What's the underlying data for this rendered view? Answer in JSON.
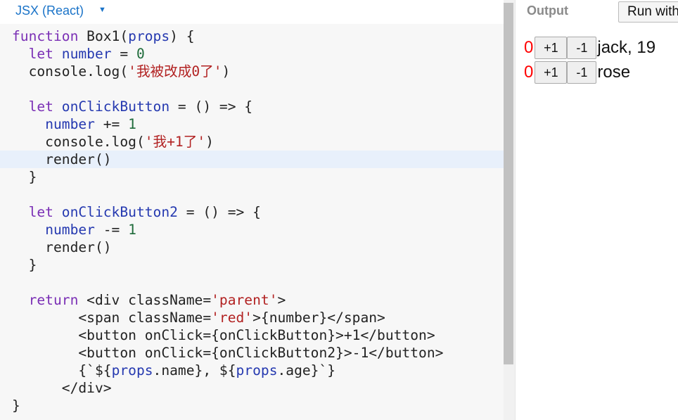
{
  "editor": {
    "language": "JSX (React)",
    "caret": "▼",
    "lines": [
      [
        {
          "t": "function",
          "c": "kw"
        },
        {
          "t": " Box1("
        },
        {
          "t": "props",
          "c": "var"
        },
        {
          "t": ") {"
        }
      ],
      [
        {
          "t": "  "
        },
        {
          "t": "let",
          "c": "kw"
        },
        {
          "t": " "
        },
        {
          "t": "number",
          "c": "var"
        },
        {
          "t": " = "
        },
        {
          "t": "0",
          "c": "num"
        }
      ],
      [
        {
          "t": "  console.log("
        },
        {
          "t": "'我被改成0了'",
          "c": "str"
        },
        {
          "t": ")"
        }
      ],
      [],
      [
        {
          "t": "  "
        },
        {
          "t": "let",
          "c": "kw"
        },
        {
          "t": " "
        },
        {
          "t": "onClickButton",
          "c": "var"
        },
        {
          "t": " = () => {"
        }
      ],
      [
        {
          "t": "    "
        },
        {
          "t": "number",
          "c": "var"
        },
        {
          "t": " += "
        },
        {
          "t": "1",
          "c": "num"
        }
      ],
      [
        {
          "t": "    console.log("
        },
        {
          "t": "'我+1了'",
          "c": "str"
        },
        {
          "t": ")"
        }
      ],
      [
        {
          "t": "    render()"
        }
      ],
      [
        {
          "t": "  }"
        }
      ],
      [],
      [
        {
          "t": "  "
        },
        {
          "t": "let",
          "c": "kw"
        },
        {
          "t": " "
        },
        {
          "t": "onClickButton2",
          "c": "var"
        },
        {
          "t": " = () => {"
        }
      ],
      [
        {
          "t": "    "
        },
        {
          "t": "number",
          "c": "var"
        },
        {
          "t": " -= "
        },
        {
          "t": "1",
          "c": "num"
        }
      ],
      [
        {
          "t": "    render()"
        }
      ],
      [
        {
          "t": "  }"
        }
      ],
      [],
      [
        {
          "t": "  "
        },
        {
          "t": "return",
          "c": "kw"
        },
        {
          "t": " <div className="
        },
        {
          "t": "'parent'",
          "c": "str"
        },
        {
          "t": ">"
        }
      ],
      [
        {
          "t": "        <span className="
        },
        {
          "t": "'red'",
          "c": "str"
        },
        {
          "t": ">{number}</span>"
        }
      ],
      [
        {
          "t": "        <button onClick={onClickButton}>+1</button>"
        }
      ],
      [
        {
          "t": "        <button onClick={onClickButton2}>-1</button>"
        }
      ],
      [
        {
          "t": "        {`${"
        },
        {
          "t": "props",
          "c": "var"
        },
        {
          "t": ".name}, ${"
        },
        {
          "t": "props",
          "c": "var"
        },
        {
          "t": ".age}`}"
        }
      ],
      [
        {
          "t": "      </div>"
        }
      ],
      [
        {
          "t": "}"
        }
      ]
    ],
    "active_line": 7
  },
  "output": {
    "title": "Output",
    "run_label": "Run with",
    "rows": [
      {
        "number": "0",
        "plus_label": "+1",
        "minus_label": "-1",
        "text": "jack, 19"
      },
      {
        "number": "0",
        "plus_label": "+1",
        "minus_label": "-1",
        "text": "rose"
      }
    ]
  },
  "colors": {
    "keyword": "#7a2fb5",
    "variable": "#2539b0",
    "number": "#1e6b3a",
    "string": "#b22222",
    "output_number": "#ff0000",
    "language_link": "#1a73c8"
  }
}
